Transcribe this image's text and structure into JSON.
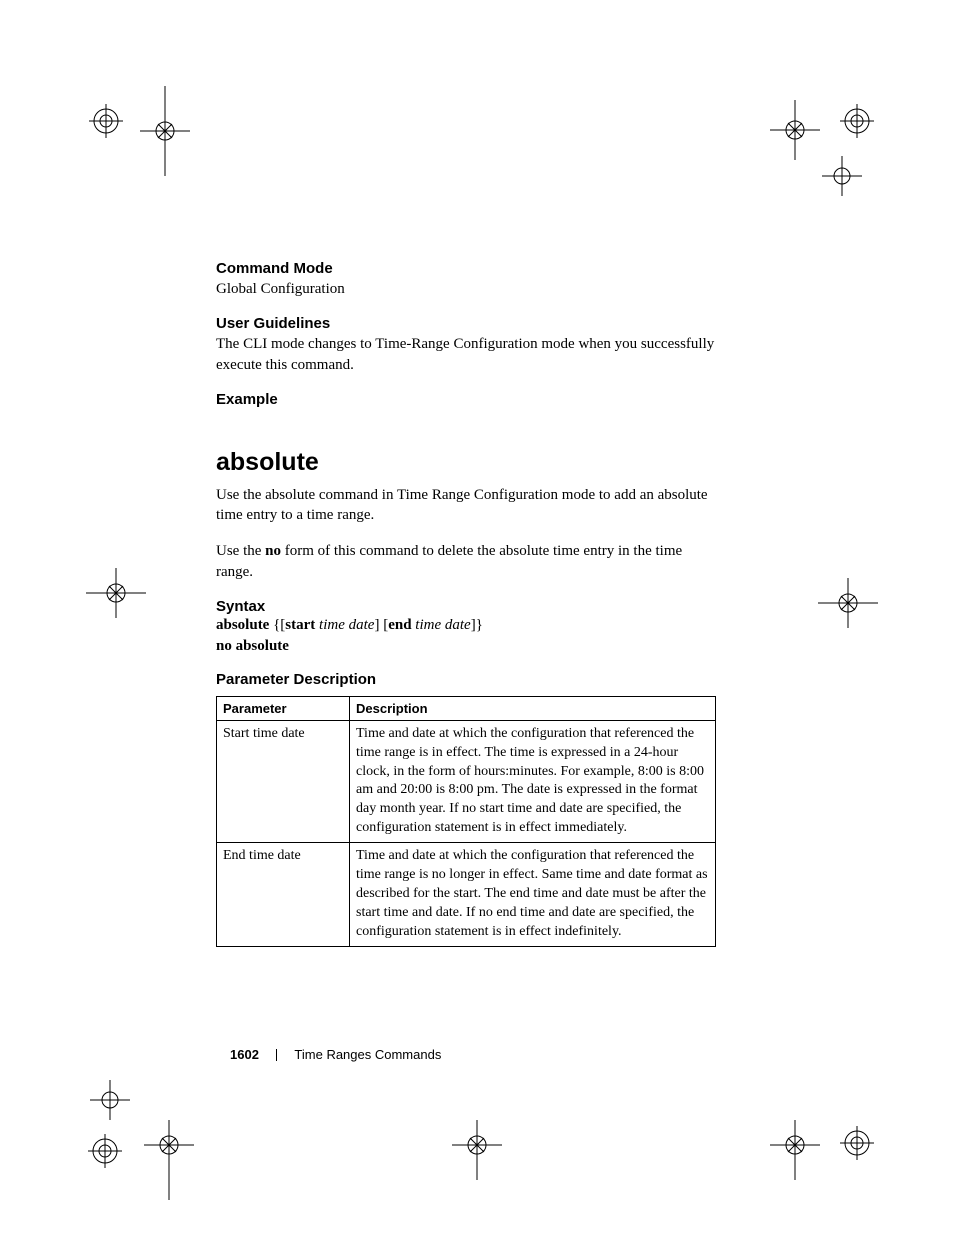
{
  "sections": {
    "command_mode": {
      "heading": "Command Mode",
      "text": "Global Configuration"
    },
    "user_guidelines": {
      "heading": "User Guidelines",
      "text": "The CLI mode changes to Time-Range Configuration mode when you successfully execute this command."
    },
    "example": {
      "heading": "Example"
    }
  },
  "command": {
    "name": "absolute",
    "desc": "Use the absolute command in Time Range Configuration mode to add an absolute time entry to a time range.",
    "no_form_pre": "Use the ",
    "no_form_bold": "no",
    "no_form_post": " form of this command to delete the absolute time entry in the time range."
  },
  "syntax": {
    "heading": "Syntax",
    "l1_a": "absolute",
    "l1_b": " {[",
    "l1_c": "start",
    "l1_d": " ",
    "l1_e": "time date",
    "l1_f": "] [",
    "l1_g": "end",
    "l1_h": " ",
    "l1_i": "time date",
    "l1_j": "]}",
    "l2": "no absolute"
  },
  "param": {
    "heading": "Parameter Description",
    "th1": "Parameter",
    "th2": "Description",
    "rows": [
      {
        "p": "Start time date",
        "d": "Time and date at which the configuration that referenced the time range is in effect. The time is expressed in a 24-hour clock, in the form of hours:minutes. For example, 8:00 is 8:00 am and 20:00 is 8:00 pm. The date is expressed in the format day month year. If no start time and date are specified, the configuration statement is in effect immediately."
      },
      {
        "p": "End time date",
        "d": "Time and date at which the configuration that referenced the time range is no longer in effect. Same time and date format as described for the start. The end time and date must be after the start time and date. If no end time and date are specified, the configuration statement is in effect indefinitely."
      }
    ]
  },
  "footer": {
    "page_number": "1602",
    "section": "Time Ranges Commands"
  }
}
